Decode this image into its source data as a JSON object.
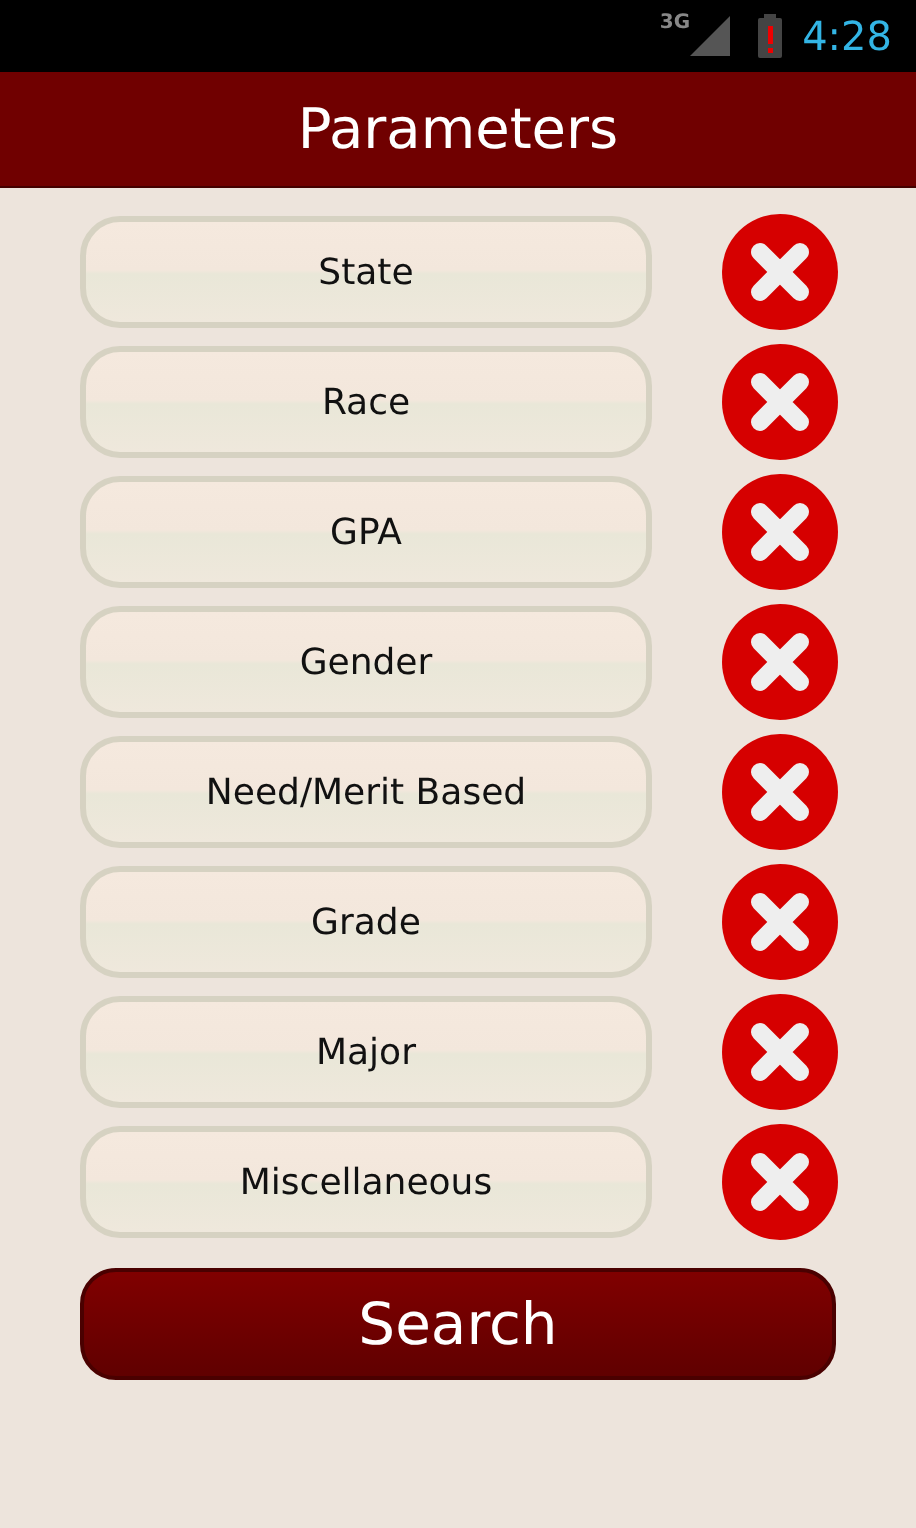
{
  "status_bar": {
    "network": "3G",
    "time": "4:28"
  },
  "title": "Parameters",
  "parameters": [
    {
      "label": "State"
    },
    {
      "label": "Race"
    },
    {
      "label": "GPA"
    },
    {
      "label": "Gender"
    },
    {
      "label": "Need/Merit Based"
    },
    {
      "label": "Grade"
    },
    {
      "label": "Major"
    },
    {
      "label": "Miscellaneous"
    }
  ],
  "search_button": "Search"
}
